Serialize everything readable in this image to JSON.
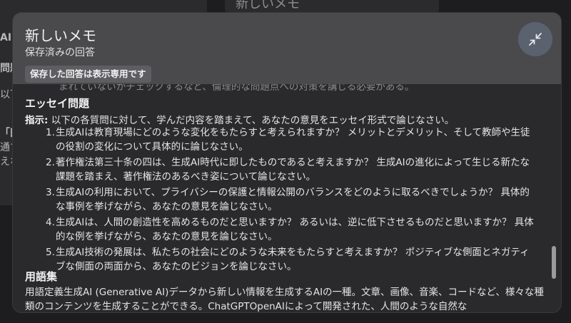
{
  "background": {
    "right_card_title": "新しいメモ",
    "left_fragments": [
      "AI",
      "問題",
      "以下",
      "「田",
      "通す",
      "えな"
    ]
  },
  "modal": {
    "title": "新しいメモ",
    "subtitle": "保存済みの回答",
    "readonly_badge": "保存した回答は表示専用です",
    "collapse_icon": "collapse-arrows-icon"
  },
  "content": {
    "faded_line": "まれていないかチェックするなど、倫理的な問題点への対策を講じる必要がある。",
    "essay": {
      "heading": "エッセイ問題",
      "instruction_label": "指示:",
      "instruction_text": " 以下の各質問に対して、学んだ内容を踏まえて、あなたの意見をエッセイ形式で論じなさい。",
      "questions": [
        {
          "num": "1.",
          "text": "生成AIは教育現場にどのような変化をもたらすと考えられますか？ メリットとデメリット、そして教師や生徒の役割の変化について具体的に論じなさい。"
        },
        {
          "num": "2.",
          "text": "著作権法第三十条の四は、生成AI時代に即したものであると考えますか？ 生成AIの進化によって生じる新たな課題を踏まえ、著作権法のあるべき姿について論じなさい。"
        },
        {
          "num": "3.",
          "text": "生成AIの利用において、プライバシーの保護と情報公開のバランスをどのように取るべきでしょうか？ 具体的な事例を挙げながら、あなたの意見を論じなさい。"
        },
        {
          "num": "4.",
          "text": "生成AIは、人間の創造性を高めるものだと思いますか？ あるいは、逆に低下させるものだと思いますか？ 具体的な例を挙げながら、あなたの意見を論じなさい。"
        },
        {
          "num": "5.",
          "text": "生成AI技術の発展は、私たちの社会にどのような未来をもたらすと考えますか？ ポジティブな側面とネガティブな側面の両面から、あなたのビジョンを論じなさい。"
        }
      ]
    },
    "glossary": {
      "heading": "用語集",
      "text": "用語定義生成AI (Generative AI)データから新しい情報を生成するAIの一種。文章、画像、音楽、コードなど、様々な種類のコンテンツを生成することができる。ChatGPTOpenAIによって開発された、人間のような自然な"
    }
  }
}
